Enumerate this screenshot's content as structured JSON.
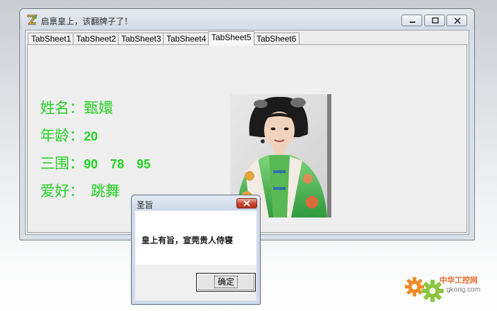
{
  "window": {
    "title": "启禀皇上，该翻牌子了！",
    "icon": "yellow-z-app-icon"
  },
  "tabs": [
    {
      "label": "TabSheet1",
      "active": false
    },
    {
      "label": "TabSheet2",
      "active": false
    },
    {
      "label": "TabSheet3",
      "active": false
    },
    {
      "label": "TabSheet4",
      "active": false
    },
    {
      "label": "TabSheet5",
      "active": true
    },
    {
      "label": "TabSheet6",
      "active": false
    }
  ],
  "profile": {
    "name_label": "姓名：",
    "name_value": "甄嬛",
    "age_label": "年龄：",
    "age_value": "20",
    "measurements_label": "三围：",
    "measurements": [
      "90",
      "78",
      "95"
    ],
    "hobby_label": "爱好：",
    "hobby_value": "跳舞",
    "text_color": "#21d321",
    "photo": "portrait-photo"
  },
  "dialog": {
    "title": "圣旨",
    "message": "皇上有旨，宣莞贵人侍寝",
    "ok_label": "确定"
  },
  "watermark": {
    "text": "中华工控网",
    "url_text": "gkong.com"
  }
}
